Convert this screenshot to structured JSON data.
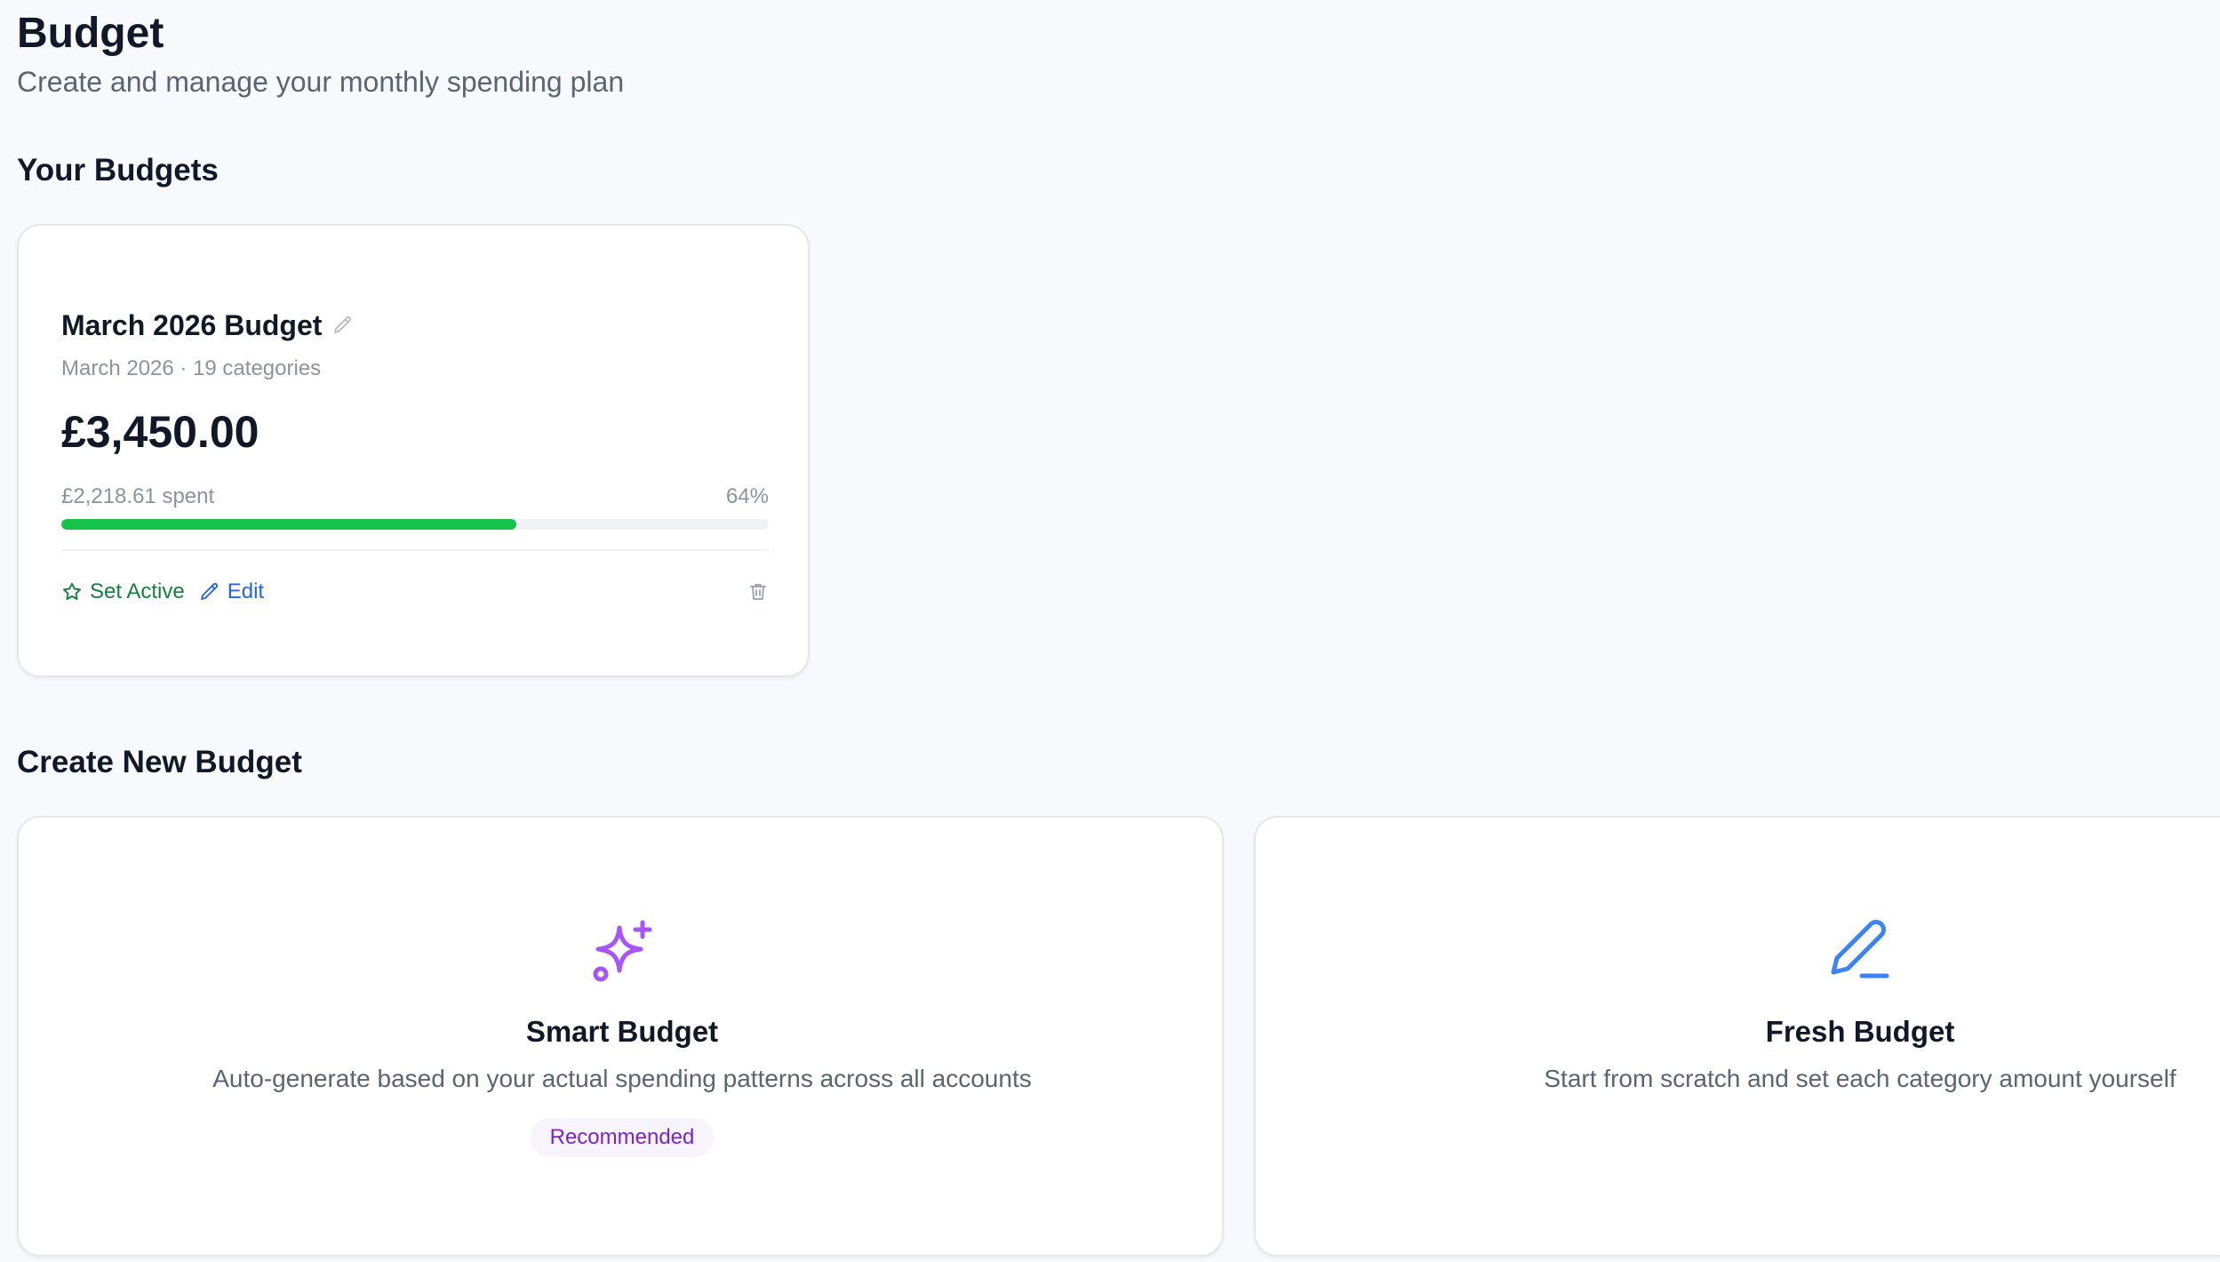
{
  "header": {
    "title": "Budget",
    "subtitle": "Create and manage your monthly spending plan"
  },
  "your_budgets": {
    "heading": "Your Budgets",
    "budgets": [
      {
        "name": "March 2026 Budget",
        "meta": "March 2026 · 19 categories",
        "amount": "£3,450.00",
        "spent_label": "£2,218.61 spent",
        "percent_label": "64%",
        "progress": 0.643,
        "progress_color": "#16c34a",
        "set_active_label": "Set Active",
        "edit_label": "Edit",
        "icons": [
          "pencil-icon",
          "star-icon",
          "edit-pencil-icon",
          "trash-icon"
        ]
      }
    ]
  },
  "create_new": {
    "heading": "Create New Budget",
    "options": [
      {
        "title": "Smart Budget",
        "description": "Auto-generate based on your actual spending patterns across all accounts",
        "badge": "Recommended",
        "icon": "sparkles-icon",
        "accent": "#a855f7"
      },
      {
        "title": "Fresh Budget",
        "description": "Start from scratch and set each category amount yourself",
        "icon": "pen-line-icon",
        "accent": "#3b82f6"
      }
    ]
  }
}
